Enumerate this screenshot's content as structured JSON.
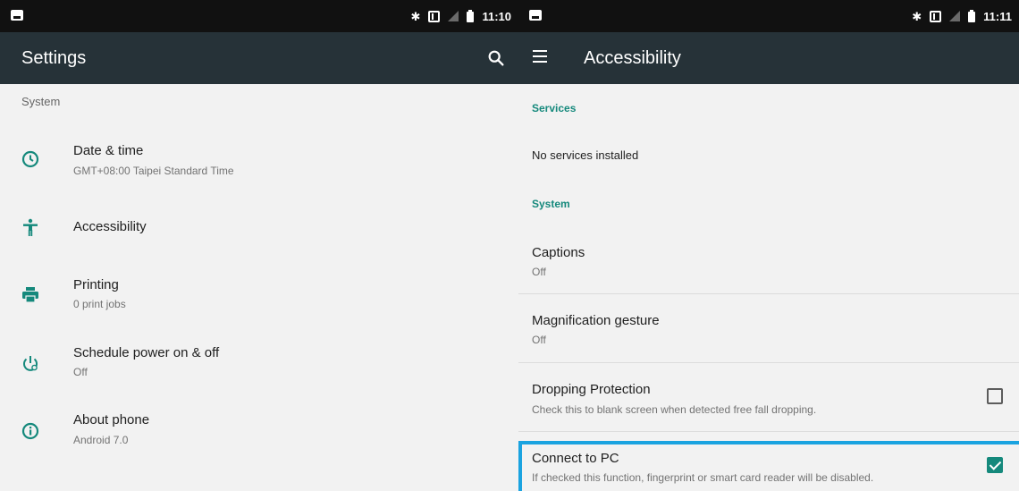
{
  "left": {
    "status_time": "11:10",
    "appbar_title": "Settings",
    "section_header": "System",
    "items": [
      {
        "icon": "clock-icon",
        "title": "Date & time",
        "subtitle": "GMT+08:00 Taipei Standard Time"
      },
      {
        "icon": "accessibility-icon",
        "title": "Accessibility",
        "subtitle": ""
      },
      {
        "icon": "printer-icon",
        "title": "Printing",
        "subtitle": "0 print jobs"
      },
      {
        "icon": "power-schedule-icon",
        "title": "Schedule power on & off",
        "subtitle": "Off"
      },
      {
        "icon": "info-icon",
        "title": "About phone",
        "subtitle": "Android 7.0"
      }
    ]
  },
  "right": {
    "status_time": "11:11",
    "appbar_title": "Accessibility",
    "services_header": "Services",
    "services_text": "No services installed",
    "system_header": "System",
    "items": [
      {
        "title": "Captions",
        "subtitle": "Off"
      },
      {
        "title": "Magnification gesture",
        "subtitle": "Off"
      },
      {
        "title": "Dropping Protection",
        "subtitle": "Check this to blank screen when detected free fall dropping.",
        "checked": false
      },
      {
        "title": "Connect to PC",
        "subtitle": "If checked this function, fingerprint or smart card reader will be disabled.",
        "checked": true
      }
    ]
  },
  "colors": {
    "appbar": "#263238",
    "accent": "#15897c",
    "highlight": "#1aa3e0"
  }
}
